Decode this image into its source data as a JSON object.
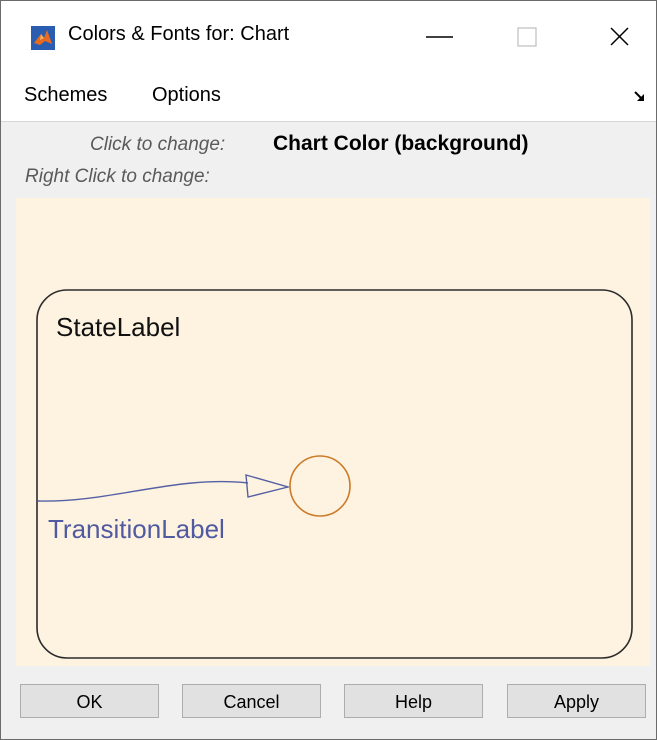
{
  "window": {
    "title": "Colors & Fonts for: Chart",
    "app_icon": "matlab-icon",
    "controls": [
      "minimize-icon",
      "maximize-icon",
      "close-icon"
    ]
  },
  "menu": {
    "items": [
      {
        "label": "Schemes"
      },
      {
        "label": "Options"
      }
    ],
    "dock_icon": "undock-arrow-icon"
  },
  "hint": {
    "click_prefix": "Click to change:",
    "click_value": "Chart Color (background)",
    "right_click_prefix": "Right Click to change:",
    "right_click_value": ""
  },
  "preview": {
    "state_label": "StateLabel",
    "transition_label": "TransitionLabel",
    "colors": {
      "background": "#fef3e0",
      "state_border": "#2b2b2b",
      "transition": "#5560a5",
      "junction": "#cc7a2a"
    }
  },
  "buttons": {
    "ok": "OK",
    "cancel": "Cancel",
    "help": "Help",
    "apply": "Apply"
  }
}
